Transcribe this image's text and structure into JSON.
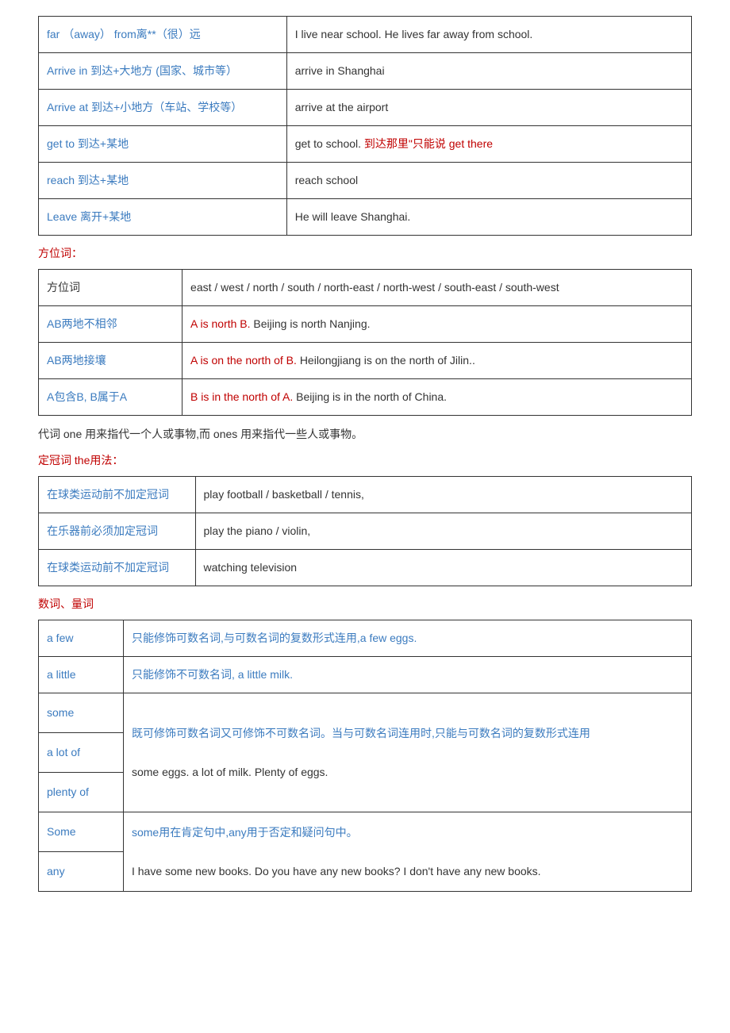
{
  "table1": {
    "rows": [
      {
        "col1": "far （away） from离**（很）远",
        "col2": "I live near school.  He lives far away from school."
      },
      {
        "col1": "Arrive in 到达+大地方 (国家、城市等）",
        "col2": "arrive in Shanghai"
      },
      {
        "col1": "Arrive at 到达+小地方（车站、学校等）",
        "col2": "arrive at the airport"
      },
      {
        "col1": "get to 到达+某地",
        "col2_before": "get to school.   ",
        "col2_red": "到达那里\"只能说 get there"
      },
      {
        "col1": "reach 到达+某地",
        "col2": "reach school"
      },
      {
        "col1": "Leave 离开+某地",
        "col2": "He will leave Shanghai."
      }
    ]
  },
  "section2_header": "方位词：",
  "table2": {
    "rows": [
      {
        "col1": "方位词",
        "col1_class": "",
        "col2": "east / west / north / south / north-east / north-west / south-east / south-west"
      },
      {
        "col1": "AB两地不相邻",
        "col2_red": "A is north B.   ",
        "col2_plain": "Beijing is north Nanjing."
      },
      {
        "col1": "AB两地接壤",
        "col2_red": "A is on the north of B.   ",
        "col2_plain": "Heilongjiang is on the north of Jilin.."
      },
      {
        "col1": "A包含B, B属于A",
        "col2_red": "B is in the north of A.  ",
        "col2_plain": "Beijing is in the north of China."
      }
    ]
  },
  "paragraph1": "代词   one 用来指代一个人或事物,而 ones 用来指代一些人或事物。",
  "section3_header": "定冠词 the用法：",
  "table3": {
    "rows": [
      {
        "col1": "在球类运动前不加定冠词",
        "col2": "play football / basketball / tennis,"
      },
      {
        "col1": "在乐器前必须加定冠词",
        "col2": "play the piano / violin,"
      },
      {
        "col1": "在球类运动前不加定冠词",
        "col2": "watching television"
      }
    ]
  },
  "section4_header": "数词、量词",
  "table4": {
    "row1": {
      "col1": "a few",
      "col2": "只能修饰可数名词,与可数名词的复数形式连用,a few eggs."
    },
    "row2": {
      "col1": "a little",
      "col2": "只能修饰不可数名词, a little milk."
    },
    "group1": {
      "cells": [
        "some",
        "a lot of",
        "plenty of"
      ],
      "line1": "既可修饰可数名词又可修饰不可数名词。当与可数名词连用时,只能与可数名词的复数形式连用",
      "line2": "some eggs.    a lot of milk.  Plenty of eggs."
    },
    "group2": {
      "cells": [
        "Some",
        "any"
      ],
      "line1": "some用在肯定句中,any用于否定和疑问句中。",
      "line2": "I have some new books.   Do you have any new books?  I don't have any new books."
    }
  }
}
